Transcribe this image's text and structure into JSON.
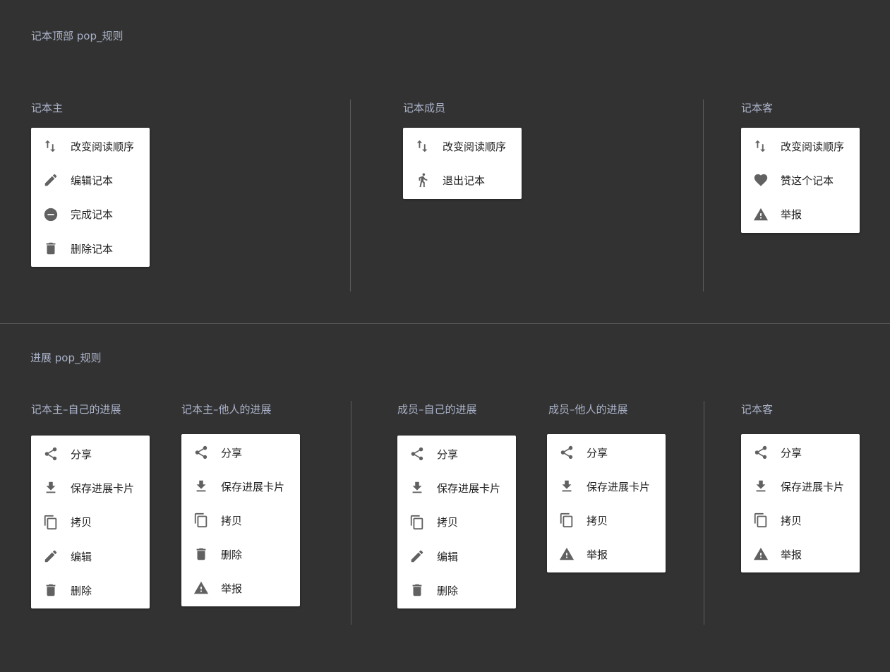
{
  "top": {
    "title": "记本顶部 pop_规则",
    "groups": [
      {
        "title": "记本主",
        "items": [
          {
            "icon": "swap-vert-icon",
            "label": "改变阅读顺序"
          },
          {
            "icon": "pencil-icon",
            "label": "编辑记本"
          },
          {
            "icon": "minus-circle-icon",
            "label": "完成记本"
          },
          {
            "icon": "trash-icon",
            "label": "删除记本"
          }
        ]
      },
      {
        "title": "记本成员",
        "items": [
          {
            "icon": "swap-vert-icon",
            "label": "改变阅读顺序"
          },
          {
            "icon": "walk-icon",
            "label": "退出记本"
          }
        ]
      },
      {
        "title": "记本客",
        "items": [
          {
            "icon": "swap-vert-icon",
            "label": "改变阅读顺序"
          },
          {
            "icon": "heart-icon",
            "label": "赞这个记本"
          },
          {
            "icon": "warning-icon",
            "label": "举报"
          }
        ]
      }
    ]
  },
  "progress": {
    "title": "进展 pop_规则",
    "groups": [
      {
        "title": "记本主–自己的进展",
        "items": [
          {
            "icon": "share-icon",
            "label": "分享"
          },
          {
            "icon": "download-icon",
            "label": "保存进展卡片"
          },
          {
            "icon": "copy-icon",
            "label": "拷贝"
          },
          {
            "icon": "pencil-icon",
            "label": "编辑"
          },
          {
            "icon": "trash-icon",
            "label": "删除"
          }
        ]
      },
      {
        "title": "记本主–他人的进展",
        "items": [
          {
            "icon": "share-icon",
            "label": "分享"
          },
          {
            "icon": "download-icon",
            "label": "保存进展卡片"
          },
          {
            "icon": "copy-icon",
            "label": "拷贝"
          },
          {
            "icon": "trash-icon",
            "label": "删除"
          },
          {
            "icon": "warning-icon",
            "label": "举报"
          }
        ]
      },
      {
        "title": "成员–自己的进展",
        "items": [
          {
            "icon": "share-icon",
            "label": "分享"
          },
          {
            "icon": "download-icon",
            "label": "保存进展卡片"
          },
          {
            "icon": "copy-icon",
            "label": "拷贝"
          },
          {
            "icon": "pencil-icon",
            "label": "编辑"
          },
          {
            "icon": "trash-icon",
            "label": "删除"
          }
        ]
      },
      {
        "title": "成员–他人的进展",
        "items": [
          {
            "icon": "share-icon",
            "label": "分享"
          },
          {
            "icon": "download-icon",
            "label": "保存进展卡片"
          },
          {
            "icon": "copy-icon",
            "label": "拷贝"
          },
          {
            "icon": "warning-icon",
            "label": "举报"
          }
        ]
      },
      {
        "title": "记本客",
        "items": [
          {
            "icon": "share-icon",
            "label": "分享"
          },
          {
            "icon": "download-icon",
            "label": "保存进展卡片"
          },
          {
            "icon": "copy-icon",
            "label": "拷贝"
          },
          {
            "icon": "warning-icon",
            "label": "举报"
          }
        ]
      }
    ]
  },
  "colors": {
    "background": "#323232",
    "title": "#aab2c8",
    "divider": "#5c5c5c",
    "menu_bg": "#ffffff",
    "icon": "#616161",
    "text": "#212121"
  }
}
